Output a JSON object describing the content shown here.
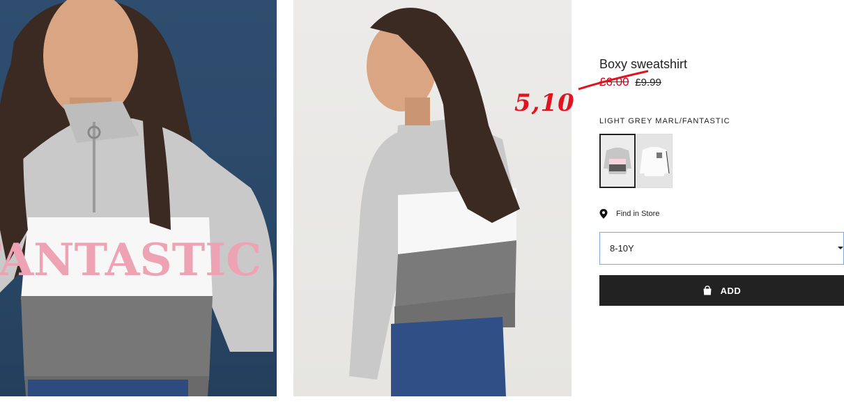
{
  "product": {
    "title": "Boxy sweatshirt",
    "sale_price": "£6.00",
    "old_price": "£9.99"
  },
  "annotation": {
    "text": "5,10",
    "color": "#e0141e"
  },
  "color": {
    "label": "LIGHT GREY MARL/FANTASTIC",
    "print_text": "FANTASTIC"
  },
  "store": {
    "label": "Find in Store",
    "icon": "map-pin-icon"
  },
  "size_select": {
    "value": "8-10Y",
    "icon": "chevron-down-icon"
  },
  "add_button": {
    "label": "ADD",
    "icon": "shopping-bag-icon",
    "bg_color": "#222222"
  },
  "colors": {
    "sale_red": "#d0021b",
    "select_border": "#7aa7e0"
  }
}
